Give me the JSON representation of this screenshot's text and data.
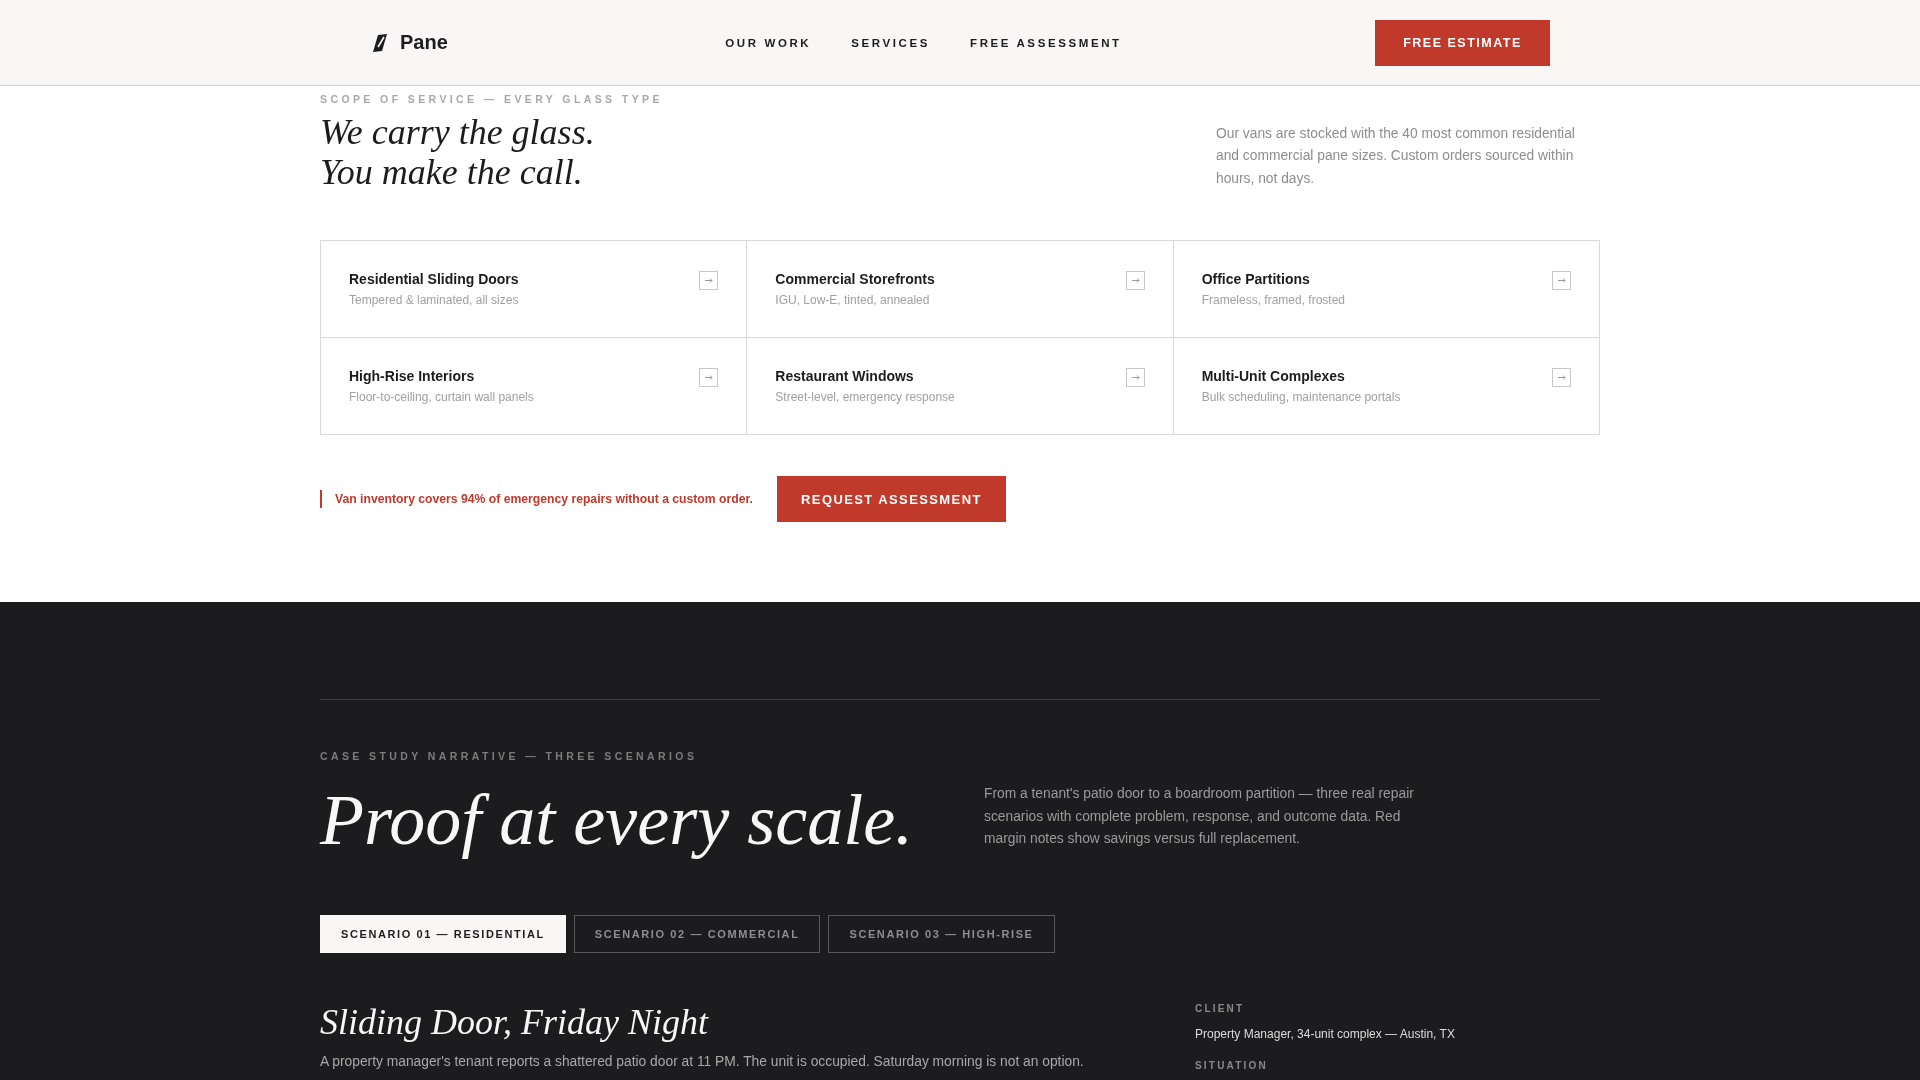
{
  "header": {
    "logo": "Pane",
    "nav": [
      "OUR WORK",
      "SERVICES",
      "FREE ASSESSMENT"
    ],
    "cta": "FREE ESTIMATE"
  },
  "scope": {
    "eyebrow": "SCOPE OF SERVICE — EVERY GLASS TYPE",
    "heading_lines": [
      "We carry the glass.",
      "You make the call."
    ],
    "intro": "Our vans are stocked with the 40 most common residential and commercial pane sizes. Custom orders sourced within hours, not days.",
    "services": [
      {
        "title": "Residential Sliding Doors",
        "detail": "Tempered & laminated, all sizes"
      },
      {
        "title": "Commercial Storefronts",
        "detail": "IGU, Low-E, tinted, annealed"
      },
      {
        "title": "Office Partitions",
        "detail": "Frameless, framed, frosted"
      },
      {
        "title": "High-Rise Interiors",
        "detail": "Floor-to-ceiling, curtain wall panels"
      },
      {
        "title": "Restaurant Windows",
        "detail": "Street-level, emergency response"
      },
      {
        "title": "Multi-Unit Complexes",
        "detail": "Bulk scheduling, maintenance portals"
      }
    ],
    "note": "Van inventory covers 94% of emergency repairs without a custom order.",
    "button": "REQUEST ASSESSMENT"
  },
  "case_studies": {
    "eyebrow": "CASE STUDY NARRATIVE — THREE SCENARIOS",
    "heading": "Proof at every scale.",
    "intro": "From a tenant's patio door to a boardroom partition — three real repair scenarios with complete problem, response, and outcome data. Red margin notes show savings versus full replacement.",
    "tabs": [
      {
        "label": "SCENARIO 01 — RESIDENTIAL",
        "selected": true
      },
      {
        "label": "SCENARIO 02 — COMMERCIAL",
        "selected": false
      },
      {
        "label": "SCENARIO 03 — HIGH-RISE",
        "selected": false
      }
    ],
    "scenario": {
      "title": "Sliding Door, Friday Night",
      "summary": "A property manager's tenant reports a shattered patio door at 11 PM. The unit is occupied. Saturday morning is not an option.",
      "facts": [
        {
          "label": "CLIENT",
          "value": "Property Manager, 34-unit complex — Austin, TX"
        },
        {
          "label": "SITUATION"
        }
      ]
    }
  }
}
